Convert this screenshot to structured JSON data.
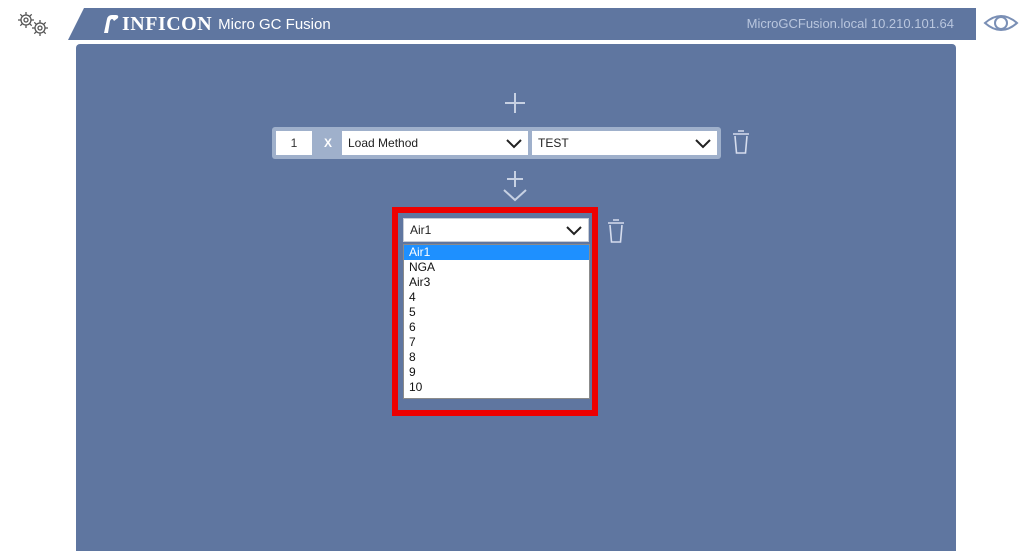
{
  "header": {
    "brand": "INFICON",
    "product": "Micro GC Fusion",
    "host": "MicroGCFusion.local 10.210.101.64"
  },
  "icons": {
    "settings": "gears-icon",
    "view": "eye-icon",
    "add": "plus-icon",
    "insert": "insert-arrow-icon",
    "delete": "trash-icon",
    "dropdown": "chevron-down-icon"
  },
  "colors": {
    "panel": "#5f76a0",
    "row": "#9fb0cb",
    "highlight": "#ee0000",
    "selected_option": "#1e90ff"
  },
  "step": {
    "number": "1",
    "remove_label": "X",
    "action": "Load Method",
    "method": "TEST"
  },
  "dropdown": {
    "selected": "Air1",
    "options": [
      "Air1",
      "NGA",
      "Air3",
      "4",
      "5",
      "6",
      "7",
      "8",
      "9",
      "10"
    ],
    "highlighted_index": 0
  }
}
